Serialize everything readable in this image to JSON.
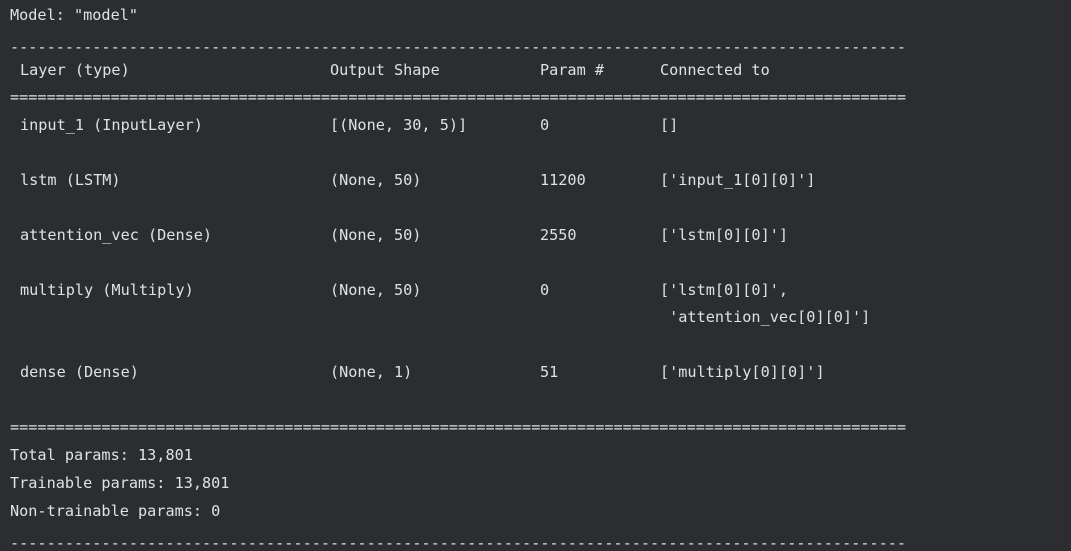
{
  "model_line": "Model: \"model\"",
  "rule_dash": "--------------------------------------------------------------------------------------------------",
  "rule_eq": "==================================================================================================",
  "header": {
    "layer": "Layer (type)",
    "output_shape": "Output Shape",
    "param": "Param #",
    "connected": "Connected to"
  },
  "rows": [
    {
      "layer": "input_1 (InputLayer)",
      "shape": "[(None, 30, 5)]",
      "param": "0",
      "connected": "[]"
    },
    {
      "layer": "lstm (LSTM)",
      "shape": "(None, 50)",
      "param": "11200",
      "connected": "['input_1[0][0]']"
    },
    {
      "layer": "attention_vec (Dense)",
      "shape": "(None, 50)",
      "param": "2550",
      "connected": "['lstm[0][0]']"
    },
    {
      "layer": "multiply (Multiply)",
      "shape": "(None, 50)",
      "param": "0",
      "connected": "['lstm[0][0]',",
      "connected2": " 'attention_vec[0][0]']"
    },
    {
      "layer": "dense (Dense)",
      "shape": "(None, 1)",
      "param": "51",
      "connected": "['multiply[0][0]']"
    }
  ],
  "summary": {
    "total": "Total params: 13,801",
    "trainable": "Trainable params: 13,801",
    "non_trainable": "Non-trainable params: 0"
  }
}
